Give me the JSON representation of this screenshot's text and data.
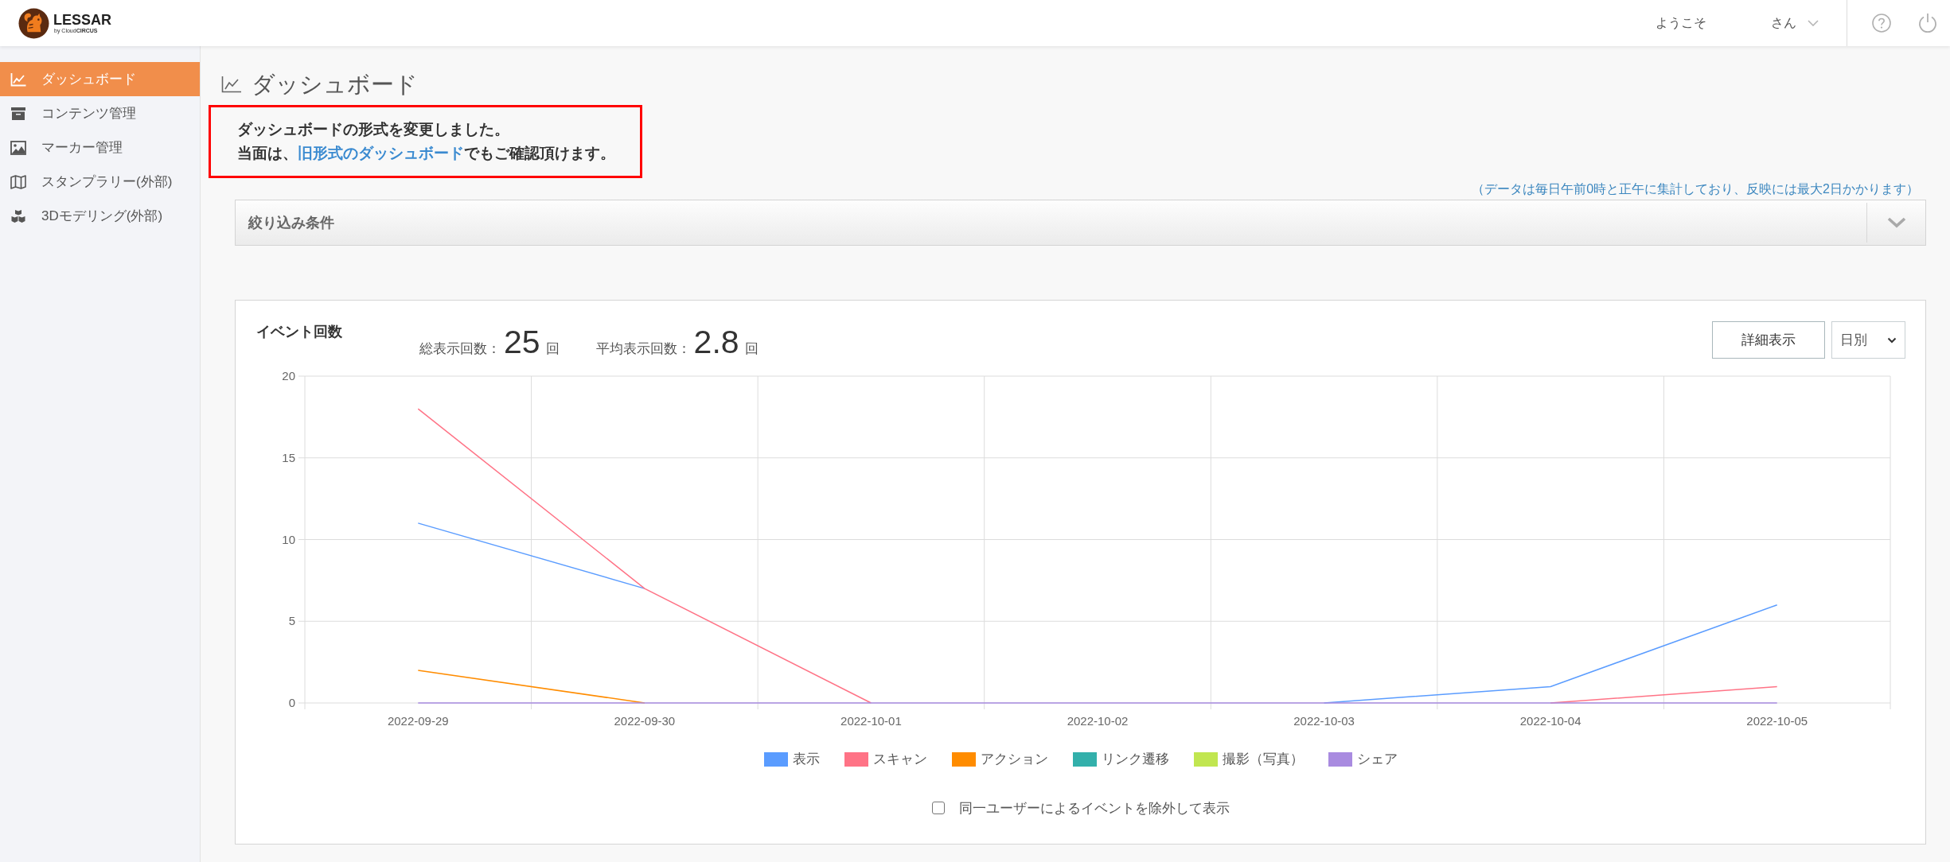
{
  "header": {
    "logo": {
      "name": "LESSAR",
      "tagline": "by Cloud**CIRCUS**"
    },
    "welcome": "ようこそ",
    "user_menu": {
      "label": "さん"
    }
  },
  "sidebar": {
    "items": [
      {
        "label": "ダッシュボード",
        "selected": true
      },
      {
        "label": "コンテンツ管理",
        "selected": false
      },
      {
        "label": "マーカー管理",
        "selected": false
      },
      {
        "label": "スタンプラリー(外部)",
        "selected": false
      },
      {
        "label": "3Dモデリング(外部)",
        "selected": false
      }
    ]
  },
  "page": {
    "title": "ダッシュボード"
  },
  "notice": {
    "line_1": "ダッシュボードの形式を変更しました。",
    "line_2": {
      "before": "当面は、",
      "link": "旧形式のダッシュボード",
      "after": "でもご確認頂けます。"
    }
  },
  "data_note": "（データは毎日午前0時と正午に集計しており、反映には最大2日かかります）",
  "filter_panel": {
    "title": "絞り込み条件",
    "expanded": false
  },
  "event_card": {
    "title": "イベント回数",
    "stats": [
      {
        "label": "総表示回数：",
        "value": "25",
        "unit": "回"
      },
      {
        "label": "平均表示回数：",
        "value": "2.8",
        "unit": "回"
      }
    ],
    "detail_button": "詳細表示",
    "period_select": {
      "value": "日別"
    },
    "chart_data": {
      "type": "line",
      "categories": [
        "2022-09-29",
        "2022-09-30",
        "2022-10-01",
        "2022-10-02",
        "2022-10-03",
        "2022-10-04",
        "2022-10-05"
      ],
      "series": [
        {
          "name": "表示",
          "color": "#5a9cff",
          "values": [
            11,
            7,
            null,
            null,
            0,
            1,
            6
          ]
        },
        {
          "name": "スキャン",
          "color": "#ff7386",
          "values": [
            18,
            7,
            0,
            null,
            null,
            0,
            1
          ]
        },
        {
          "name": "アクション",
          "color": "#ff8c00",
          "values": [
            2,
            0,
            null,
            null,
            null,
            null,
            null
          ]
        },
        {
          "name": "リンク遷移",
          "color": "#33b0ab",
          "values": [
            null,
            null,
            null,
            null,
            null,
            null,
            null
          ]
        },
        {
          "name": "撮影（写真）",
          "color": "#c1e650",
          "values": [
            null,
            null,
            null,
            null,
            null,
            null,
            null
          ]
        },
        {
          "name": "シェア",
          "color": "#a98be0",
          "values": [
            0,
            0,
            0,
            0,
            0,
            0,
            0
          ]
        }
      ],
      "ylim": [
        0,
        20
      ],
      "yticks": [
        0,
        5,
        10,
        15,
        20
      ],
      "grid": true,
      "legend": "bottom"
    },
    "exclude_same_user": {
      "label": "同一ユーザーによるイベントを除外して表示",
      "checked": false
    }
  }
}
